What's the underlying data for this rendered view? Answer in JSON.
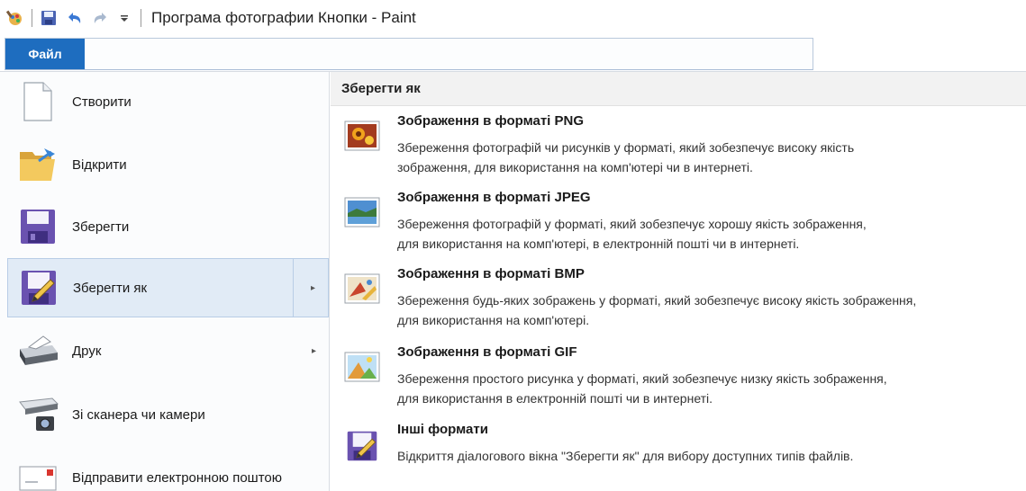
{
  "window": {
    "title": "Програма фотографии Кнопки - Paint"
  },
  "quick_access": [
    "paint-app-icon",
    "save-icon",
    "undo-icon",
    "redo-icon",
    "customize-dropdown-icon"
  ],
  "ribbon": {
    "file_tab": "Файл"
  },
  "left_menu": {
    "items": [
      {
        "label": "Створити",
        "icon": "new-document-icon"
      },
      {
        "label": "Відкрити",
        "icon": "open-folder-icon"
      },
      {
        "label": "Зберегти",
        "icon": "save-icon"
      },
      {
        "label": "Зберегти як",
        "icon": "save-as-icon",
        "selected": true,
        "has_submenu": true
      },
      {
        "label": "Друк",
        "icon": "printer-icon",
        "has_submenu": true
      },
      {
        "label": "Зі сканера чи камери",
        "icon": "scanner-camera-icon"
      },
      {
        "label": "Відправити електронною поштою",
        "icon": "email-icon"
      }
    ],
    "submenu_arrow": "▸"
  },
  "submenu": {
    "heading": "Зберегти як",
    "options": [
      {
        "title": "Зображення в форматі PNG",
        "line1": "Збереження фотографій чи рисунків у форматі, який зобезпечує високу якість",
        "line2": "зображення, для використання на комп'ютері чи в интернеті.",
        "icon": "png-image-icon"
      },
      {
        "title": "Зображення в форматі JPEG",
        "line1": "Збереження фотографій у форматі, який зобезпечує хорошу якість зображення,",
        "line2": "для використання на комп'ютері, в електронній пошті чи в интернеті.",
        "icon": "jpeg-image-icon"
      },
      {
        "title": "Зображення в форматі BMP",
        "line1": "Збереження будь-яких зображень у форматі, який зобезпечує високу якість зображення,",
        "line2": "для використання на комп'ютері.",
        "icon": "bmp-image-icon"
      },
      {
        "title": "Зображення в форматі GIF",
        "line1": "Збереження простого рисунка у форматі, який зобезпечує низку якість зображення,",
        "line2": "для використання в електронній пошті чи в интернеті.",
        "icon": "gif-image-icon"
      },
      {
        "title": "Інші формати",
        "line1": "Відкриття діалогового вікна \"Зберегти як\" для вибору доступних типів файлів.",
        "line2": "",
        "icon": "other-formats-icon"
      }
    ]
  }
}
